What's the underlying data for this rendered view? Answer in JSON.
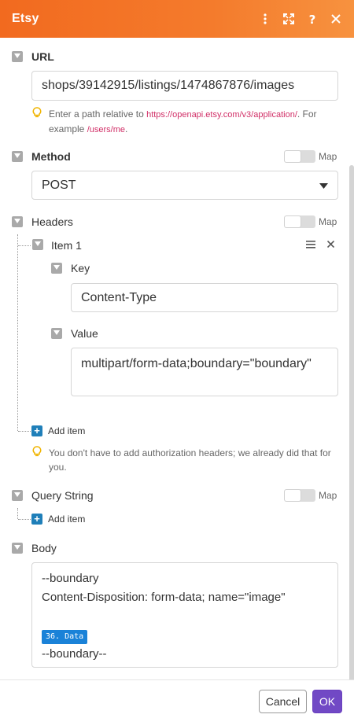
{
  "header": {
    "title": "Etsy",
    "accent": "#f47b2c"
  },
  "url": {
    "label": "URL",
    "value": "shops/39142915/listings/1474867876/images",
    "hint_prefix": "Enter a path relative to ",
    "hint_link": "https://openapi.etsy.com/v3/application/",
    "hint_mid": ". For example ",
    "hint_example": "/users/me",
    "hint_suffix": "."
  },
  "method": {
    "label": "Method",
    "map_label": "Map",
    "selected": "POST"
  },
  "headers": {
    "label": "Headers",
    "map_label": "Map",
    "item_label": "Item 1",
    "key_label": "Key",
    "key_value": "Content-Type",
    "value_label": "Value",
    "value_value": "multipart/form-data;boundary=\"boundary\"",
    "add_item": "Add item",
    "hint": "You don't have to add authorization headers; we already did that for you."
  },
  "query_string": {
    "label": "Query String",
    "map_label": "Map",
    "add_item": "Add item"
  },
  "body": {
    "label": "Body",
    "line1": "--boundary",
    "line2": "Content-Disposition: form-data; name=\"image\"",
    "pill": "36. Data",
    "line4": "--boundary--"
  },
  "footer": {
    "cancel": "Cancel",
    "ok": "OK",
    "ok_color": "#7149c5"
  }
}
